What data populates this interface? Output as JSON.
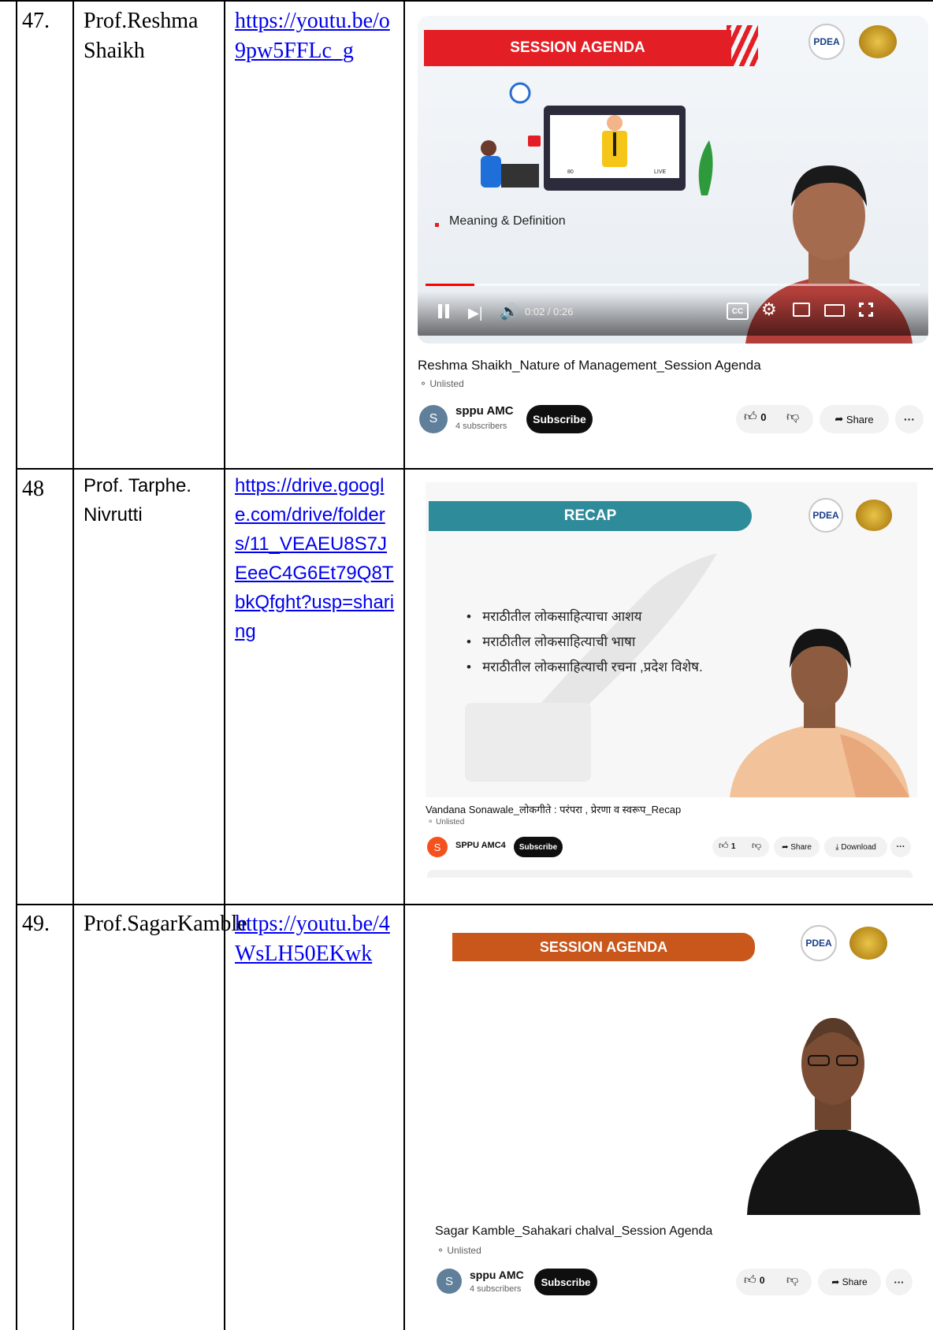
{
  "rows": [
    {
      "no": "47.",
      "name": "Prof.Reshma Shaikh",
      "link": "https://youtu.be/o9pw5FFLc_g",
      "video": {
        "banner": "SESSION AGENDA",
        "bullet": "Meaning & Definition",
        "time": "0:02 / 0:26",
        "cc": "CC",
        "title": "Reshma Shaikh_Nature of Management_Session Agenda",
        "visibility": "Unlisted",
        "avatar_letter": "S",
        "channel": "sppu AMC",
        "subscribers": "4 subscribers",
        "subscribe_label": "Subscribe",
        "likes": "0",
        "share_label": "Share",
        "more_label": "···",
        "logo_text": "PDEA",
        "illustration_views": "80",
        "illustration_live": "LIVE"
      }
    },
    {
      "no": "48",
      "name": "Prof. Tarphe. Nivrutti",
      "link": "https://drive.google.com/drive/folders/11_VEAEU8S7JEeeC4G6Et79Q8TbkQfght?usp=sharing",
      "video": {
        "banner": "RECAP",
        "bullets": [
          "मराठीतील लोकसाहित्याचा आशय",
          "मराठीतील लोकसाहित्याची भाषा",
          "मराठीतील लोकसाहित्याची रचना ,प्रदेश विशेष."
        ],
        "title": "Vandana Sonawale_लोकगीते : परंपरा , प्रेरणा व स्वरूप_Recap",
        "visibility": "Unlisted",
        "avatar_letter": "S",
        "channel": "SPPU AMC4",
        "subscribe_label": "Subscribe",
        "likes": "1",
        "share_label": "Share",
        "download_label": "Download",
        "more_label": "···",
        "logo_text": "PDEA"
      }
    },
    {
      "no": "49.",
      "name": "Prof.SagarKamble",
      "link": "https://youtu.be/4WsLH50EKwk",
      "video": {
        "banner": "SESSION AGENDA",
        "title": "Sagar Kamble_Sahakari chalval_Session Agenda",
        "visibility": "Unlisted",
        "avatar_letter": "S",
        "channel": "sppu AMC",
        "subscribers": "4 subscribers",
        "subscribe_label": "Subscribe",
        "likes": "0",
        "share_label": "Share",
        "more_label": "···",
        "logo_text": "PDEA"
      }
    }
  ],
  "colors": {
    "link": "#0000ee",
    "banner_red": "#e31e24",
    "banner_teal": "#2e8b9a",
    "banner_orange": "#c9561a",
    "progress_red": "#ff0000"
  }
}
